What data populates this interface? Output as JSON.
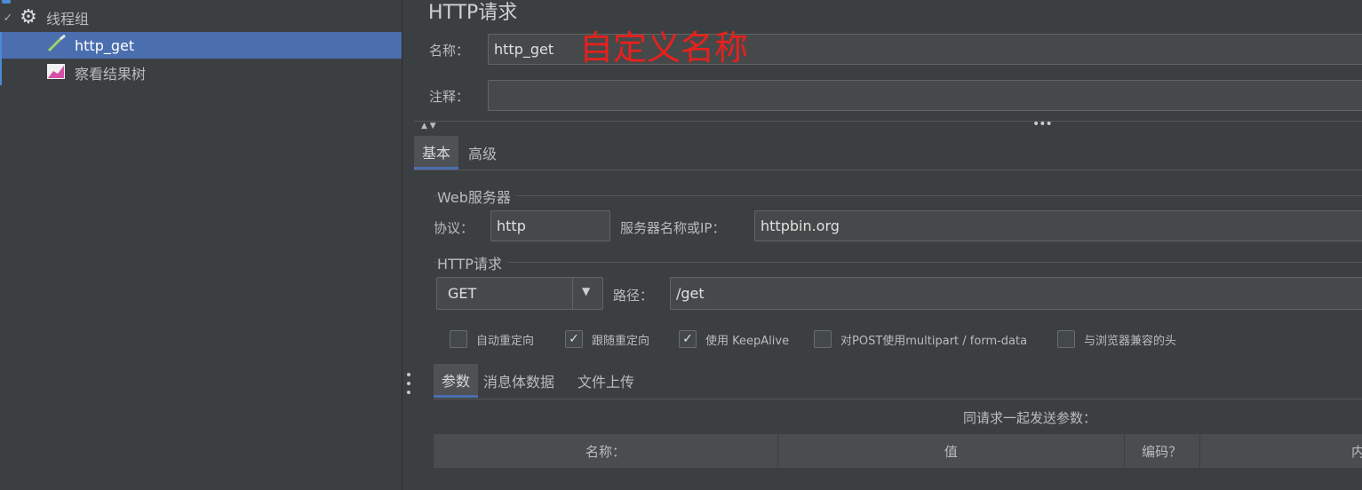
{
  "tree": {
    "thread_group": "线程组",
    "http_get": "http_get",
    "result_tree": "察看结果树"
  },
  "panel": {
    "title": "HTTP请求",
    "name_label": "名称：",
    "name_value": "http_get",
    "annotation": "自定义名称",
    "comment_label": "注释：",
    "comment_value": ""
  },
  "tabs": {
    "basic": "基本",
    "advanced": "高级"
  },
  "web_server": {
    "title": "Web服务器",
    "protocol_label": "协议：",
    "protocol_value": "http",
    "server_label": "服务器名称或IP：",
    "server_value": "httpbin.org"
  },
  "http_request": {
    "title": "HTTP请求",
    "method": "GET",
    "path_label": "路径：",
    "path_value": "/get"
  },
  "options": [
    {
      "label": "自动重定向",
      "checked": false
    },
    {
      "label": "跟随重定向",
      "checked": true
    },
    {
      "label": "使用 KeepAlive",
      "checked": true
    },
    {
      "label": "对POST使用multipart / form-data",
      "checked": false
    },
    {
      "label": "与浏览器兼容的头",
      "checked": false
    }
  ],
  "param_tabs": {
    "params": "参数",
    "body": "消息体数据",
    "files": "文件上传"
  },
  "params_table": {
    "caption": "同请求一起发送参数：",
    "columns": [
      "名称：",
      "值",
      "编码？",
      "内容"
    ]
  },
  "colors": {
    "accent": "#4b6eaf",
    "annotation": "#e8201c"
  }
}
